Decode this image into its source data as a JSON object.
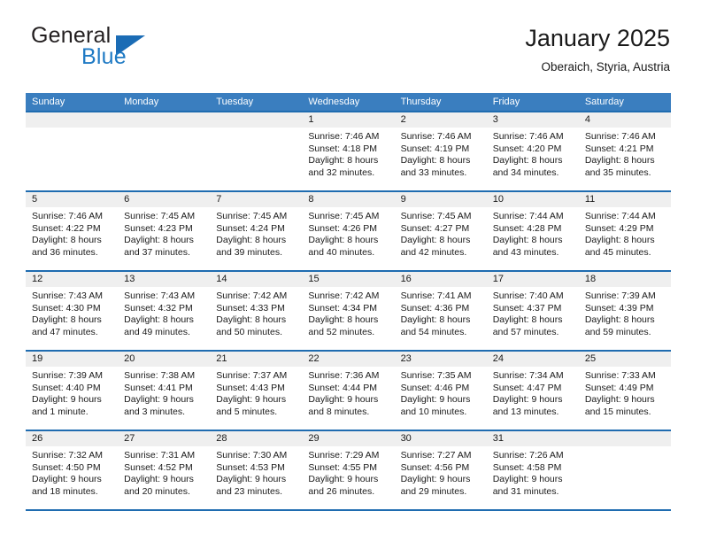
{
  "brand": {
    "name_part1": "General",
    "name_part2": "Blue",
    "logo_icon": "triangle-logo-icon",
    "accent_color": "#1b6cb5"
  },
  "header": {
    "title": "January 2025",
    "location": "Oberaich, Styria, Austria"
  },
  "theme": {
    "header_row_bg": "#3a7ebf",
    "separator_color": "#1f6cb0",
    "day_band_bg": "#efefef",
    "text_color": "#1a1a1a"
  },
  "calendar": {
    "weekday_headers": [
      "Sunday",
      "Monday",
      "Tuesday",
      "Wednesday",
      "Thursday",
      "Friday",
      "Saturday"
    ],
    "weeks": [
      [
        {
          "day": "",
          "lines": []
        },
        {
          "day": "",
          "lines": []
        },
        {
          "day": "",
          "lines": []
        },
        {
          "day": "1",
          "lines": [
            "Sunrise: 7:46 AM",
            "Sunset: 4:18 PM",
            "Daylight: 8 hours",
            "and 32 minutes."
          ]
        },
        {
          "day": "2",
          "lines": [
            "Sunrise: 7:46 AM",
            "Sunset: 4:19 PM",
            "Daylight: 8 hours",
            "and 33 minutes."
          ]
        },
        {
          "day": "3",
          "lines": [
            "Sunrise: 7:46 AM",
            "Sunset: 4:20 PM",
            "Daylight: 8 hours",
            "and 34 minutes."
          ]
        },
        {
          "day": "4",
          "lines": [
            "Sunrise: 7:46 AM",
            "Sunset: 4:21 PM",
            "Daylight: 8 hours",
            "and 35 minutes."
          ]
        }
      ],
      [
        {
          "day": "5",
          "lines": [
            "Sunrise: 7:46 AM",
            "Sunset: 4:22 PM",
            "Daylight: 8 hours",
            "and 36 minutes."
          ]
        },
        {
          "day": "6",
          "lines": [
            "Sunrise: 7:45 AM",
            "Sunset: 4:23 PM",
            "Daylight: 8 hours",
            "and 37 minutes."
          ]
        },
        {
          "day": "7",
          "lines": [
            "Sunrise: 7:45 AM",
            "Sunset: 4:24 PM",
            "Daylight: 8 hours",
            "and 39 minutes."
          ]
        },
        {
          "day": "8",
          "lines": [
            "Sunrise: 7:45 AM",
            "Sunset: 4:26 PM",
            "Daylight: 8 hours",
            "and 40 minutes."
          ]
        },
        {
          "day": "9",
          "lines": [
            "Sunrise: 7:45 AM",
            "Sunset: 4:27 PM",
            "Daylight: 8 hours",
            "and 42 minutes."
          ]
        },
        {
          "day": "10",
          "lines": [
            "Sunrise: 7:44 AM",
            "Sunset: 4:28 PM",
            "Daylight: 8 hours",
            "and 43 minutes."
          ]
        },
        {
          "day": "11",
          "lines": [
            "Sunrise: 7:44 AM",
            "Sunset: 4:29 PM",
            "Daylight: 8 hours",
            "and 45 minutes."
          ]
        }
      ],
      [
        {
          "day": "12",
          "lines": [
            "Sunrise: 7:43 AM",
            "Sunset: 4:30 PM",
            "Daylight: 8 hours",
            "and 47 minutes."
          ]
        },
        {
          "day": "13",
          "lines": [
            "Sunrise: 7:43 AM",
            "Sunset: 4:32 PM",
            "Daylight: 8 hours",
            "and 49 minutes."
          ]
        },
        {
          "day": "14",
          "lines": [
            "Sunrise: 7:42 AM",
            "Sunset: 4:33 PM",
            "Daylight: 8 hours",
            "and 50 minutes."
          ]
        },
        {
          "day": "15",
          "lines": [
            "Sunrise: 7:42 AM",
            "Sunset: 4:34 PM",
            "Daylight: 8 hours",
            "and 52 minutes."
          ]
        },
        {
          "day": "16",
          "lines": [
            "Sunrise: 7:41 AM",
            "Sunset: 4:36 PM",
            "Daylight: 8 hours",
            "and 54 minutes."
          ]
        },
        {
          "day": "17",
          "lines": [
            "Sunrise: 7:40 AM",
            "Sunset: 4:37 PM",
            "Daylight: 8 hours",
            "and 57 minutes."
          ]
        },
        {
          "day": "18",
          "lines": [
            "Sunrise: 7:39 AM",
            "Sunset: 4:39 PM",
            "Daylight: 8 hours",
            "and 59 minutes."
          ]
        }
      ],
      [
        {
          "day": "19",
          "lines": [
            "Sunrise: 7:39 AM",
            "Sunset: 4:40 PM",
            "Daylight: 9 hours",
            "and 1 minute."
          ]
        },
        {
          "day": "20",
          "lines": [
            "Sunrise: 7:38 AM",
            "Sunset: 4:41 PM",
            "Daylight: 9 hours",
            "and 3 minutes."
          ]
        },
        {
          "day": "21",
          "lines": [
            "Sunrise: 7:37 AM",
            "Sunset: 4:43 PM",
            "Daylight: 9 hours",
            "and 5 minutes."
          ]
        },
        {
          "day": "22",
          "lines": [
            "Sunrise: 7:36 AM",
            "Sunset: 4:44 PM",
            "Daylight: 9 hours",
            "and 8 minutes."
          ]
        },
        {
          "day": "23",
          "lines": [
            "Sunrise: 7:35 AM",
            "Sunset: 4:46 PM",
            "Daylight: 9 hours",
            "and 10 minutes."
          ]
        },
        {
          "day": "24",
          "lines": [
            "Sunrise: 7:34 AM",
            "Sunset: 4:47 PM",
            "Daylight: 9 hours",
            "and 13 minutes."
          ]
        },
        {
          "day": "25",
          "lines": [
            "Sunrise: 7:33 AM",
            "Sunset: 4:49 PM",
            "Daylight: 9 hours",
            "and 15 minutes."
          ]
        }
      ],
      [
        {
          "day": "26",
          "lines": [
            "Sunrise: 7:32 AM",
            "Sunset: 4:50 PM",
            "Daylight: 9 hours",
            "and 18 minutes."
          ]
        },
        {
          "day": "27",
          "lines": [
            "Sunrise: 7:31 AM",
            "Sunset: 4:52 PM",
            "Daylight: 9 hours",
            "and 20 minutes."
          ]
        },
        {
          "day": "28",
          "lines": [
            "Sunrise: 7:30 AM",
            "Sunset: 4:53 PM",
            "Daylight: 9 hours",
            "and 23 minutes."
          ]
        },
        {
          "day": "29",
          "lines": [
            "Sunrise: 7:29 AM",
            "Sunset: 4:55 PM",
            "Daylight: 9 hours",
            "and 26 minutes."
          ]
        },
        {
          "day": "30",
          "lines": [
            "Sunrise: 7:27 AM",
            "Sunset: 4:56 PM",
            "Daylight: 9 hours",
            "and 29 minutes."
          ]
        },
        {
          "day": "31",
          "lines": [
            "Sunrise: 7:26 AM",
            "Sunset: 4:58 PM",
            "Daylight: 9 hours",
            "and 31 minutes."
          ]
        },
        {
          "day": "",
          "lines": []
        }
      ]
    ]
  }
}
